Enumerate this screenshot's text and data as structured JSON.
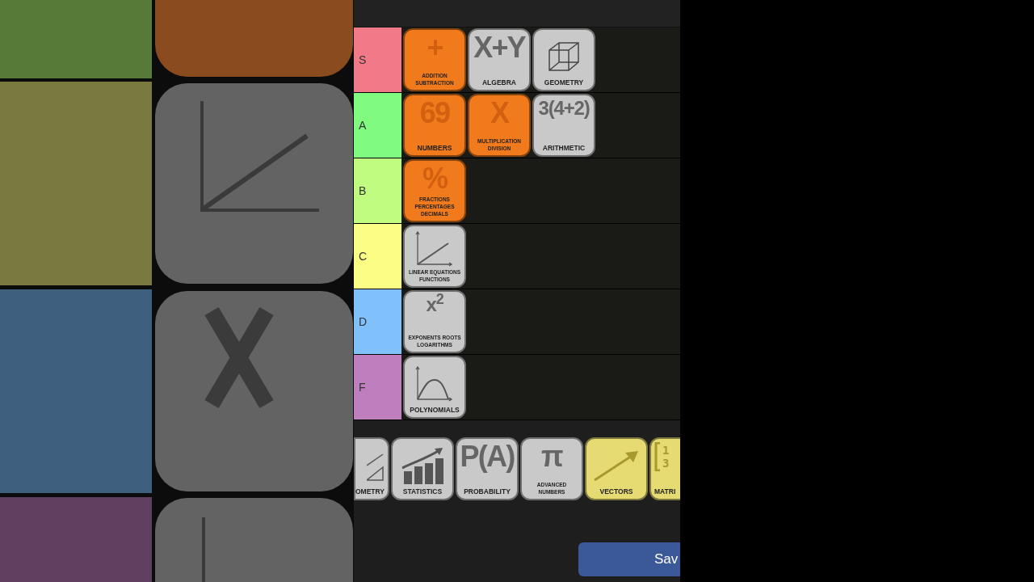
{
  "tiers": [
    {
      "label": "S",
      "color": "#f27a88",
      "items": [
        {
          "kind": "text",
          "symbol": "+",
          "label": "ADDITION SUBTRACTION",
          "color": "#f07a1c"
        },
        {
          "kind": "text",
          "symbol": "X+Y",
          "label": "ALGEBRA",
          "color": "#c9c9c9"
        },
        {
          "kind": "cube",
          "label": "GEOMETRY",
          "color": "#c9c9c9"
        }
      ]
    },
    {
      "label": "A",
      "color": "#80fb80",
      "items": [
        {
          "kind": "text",
          "symbol": "69",
          "label": "NUMBERS",
          "color": "#f07a1c"
        },
        {
          "kind": "text",
          "symbol": "X",
          "label": "MULTIPLICATION DIVISION",
          "color": "#f07a1c"
        },
        {
          "kind": "text",
          "symbol": "3(4+2)",
          "label": "ARITHMETIC",
          "color": "#c9c9c9"
        }
      ]
    },
    {
      "label": "B",
      "color": "#c0fc80",
      "items": [
        {
          "kind": "text",
          "symbol": "%",
          "label": "FRACTIONS PERCENTAGES DECIMALS",
          "color": "#f07a1c"
        }
      ]
    },
    {
      "label": "C",
      "color": "#fbfd84",
      "items": [
        {
          "kind": "line-graph",
          "label": "LINEAR EQUATIONS FUNCTIONS",
          "color": "#c9c9c9"
        }
      ]
    },
    {
      "label": "D",
      "color": "#80c0fb",
      "items": [
        {
          "kind": "text",
          "symbol": "x$^{2}$",
          "label": "EXPONENTS ROOTS LOGARITHMS",
          "color": "#c9c9c9"
        }
      ]
    },
    {
      "label": "F",
      "color": "#bf7fbf",
      "items": [
        {
          "kind": "curve-graph",
          "label": "POLYNOMIALS",
          "color": "#c9c9c9"
        }
      ]
    }
  ],
  "pool": [
    {
      "kind": "triangle",
      "label": "OMETRY",
      "color": "#c9c9c9",
      "clipped_left": true
    },
    {
      "kind": "bar-chart",
      "label": "STATISTICS",
      "color": "#c9c9c9"
    },
    {
      "kind": "text",
      "symbol": "P(A)",
      "label": "PROBABILITY",
      "color": "#c9c9c9"
    },
    {
      "kind": "text",
      "symbol": "π",
      "label": "ADVANCED NUMBERS",
      "color": "#c9c9c9"
    },
    {
      "kind": "arrow",
      "label": "VECTORS",
      "color": "#e6da72"
    },
    {
      "kind": "matrix",
      "symbol": "1\n3",
      "label": "MATRI",
      "color": "#e6da72",
      "clipped_right": true
    }
  ],
  "save_button": "Sav"
}
